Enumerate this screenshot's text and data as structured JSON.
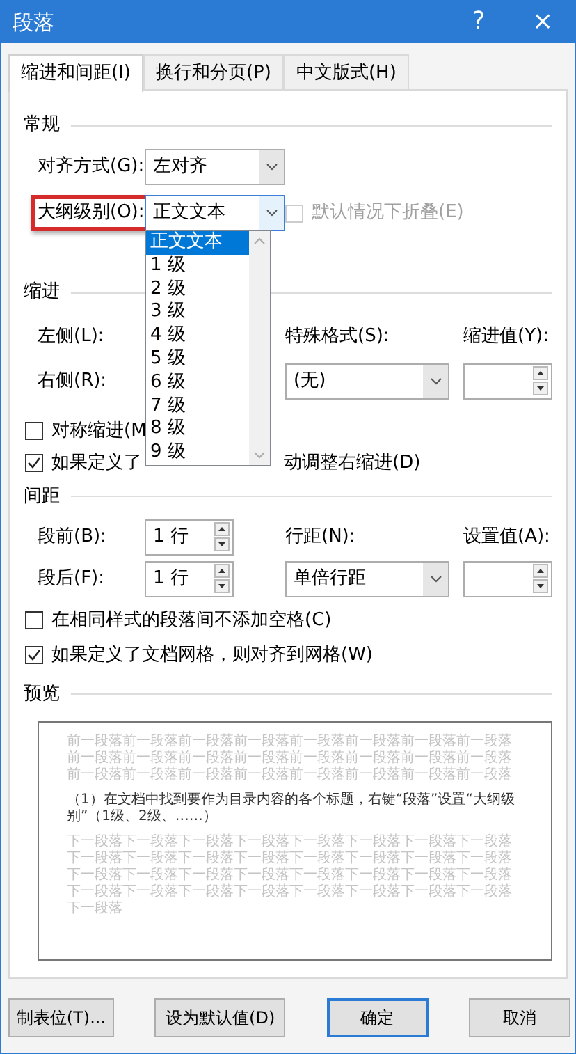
{
  "window": {
    "title": "段落",
    "help": "?",
    "close": "×"
  },
  "tabs": [
    {
      "label": "缩进和间距(I)",
      "selected": true
    },
    {
      "label": "换行和分页(P)",
      "selected": false
    },
    {
      "label": "中文版式(H)",
      "selected": false
    }
  ],
  "general": {
    "heading": "常规",
    "alignment": {
      "label": "对齐方式(G):",
      "value": "左对齐"
    },
    "outline_level": {
      "label": "大纲级别(O):",
      "value": "正文文本",
      "highlighted": true
    },
    "collapse": {
      "label": "默认情况下折叠(E)",
      "checked": false,
      "disabled": true
    }
  },
  "outline_dropdown": {
    "items": [
      {
        "label": "正文文本",
        "selected": true
      },
      {
        "label": "1 级",
        "selected": false
      },
      {
        "label": "2 级",
        "selected": false
      },
      {
        "label": "3 级",
        "selected": false
      },
      {
        "label": "4 级",
        "selected": false
      },
      {
        "label": "5 级",
        "selected": false
      },
      {
        "label": "6 级",
        "selected": false
      },
      {
        "label": "7 级",
        "selected": false
      },
      {
        "label": "8 级",
        "selected": false
      },
      {
        "label": "9 级",
        "selected": false
      }
    ]
  },
  "indent": {
    "heading": "缩进",
    "left_label": "左侧(L):",
    "right_label": "右侧(R):",
    "special_label": "特殊格式(S):",
    "special_value": "(无)",
    "by_label": "缩进值(Y):",
    "mirror": {
      "label": "对称缩进(M",
      "checked": false
    },
    "auto_adjust": {
      "label_start": "如果定义了",
      "label_end": "动调整右缩进(D)",
      "checked": true
    }
  },
  "spacing": {
    "heading": "间距",
    "before_label": "段前(B):",
    "before_value": "1 行",
    "after_label": "段后(F):",
    "after_value": "1 行",
    "line_label": "行距(N):",
    "line_value": "单倍行距",
    "at_label": "设置值(A):",
    "options": [
      {
        "label": "在相同样式的段落间不添加空格(C)",
        "checked": false
      },
      {
        "label": "如果定义了文档网格，则对齐到网格(W)",
        "checked": true
      }
    ]
  },
  "preview": {
    "heading": "预览",
    "paragraphs": [
      {
        "kind": "previous",
        "text": "前一段落前一段落前一段落前一段落前一段落前一段落前一段落前一段落前一段落前一段落前一段落前一段落前一段落前一段落前一段落前一段落前一段落前一段落前一段落前一段落前一段落前一段落前一段落前一段落"
      },
      {
        "kind": "sample",
        "text": "（1）在文档中找到要作为目录内容的各个标题，右键“段落”设置“大纲级别”（1级、2级、……）"
      },
      {
        "kind": "next",
        "text": "下一段落下一段落下一段落下一段落下一段落下一段落下一段落下一段落下一段落下一段落下一段落下一段落下一段落下一段落下一段落下一段落下一段落下一段落下一段落下一段落下一段落下一段落下一段落下一段落下一段落下一段落下一段落下一段落下一段落下一段落下一段落下一段落下一段落"
      }
    ]
  },
  "buttons": [
    {
      "label": "制表位(T)...",
      "default": false
    },
    {
      "label": "设为默认值(D)",
      "default": false
    },
    {
      "label": "确定",
      "default": true
    },
    {
      "label": "取消",
      "default": false
    }
  ]
}
